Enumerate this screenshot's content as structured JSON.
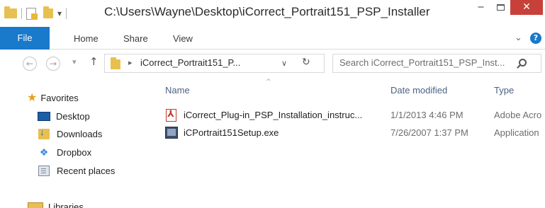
{
  "window": {
    "title": "C:\\Users\\Wayne\\Desktop\\iCorrect_Portrait151_PSP_Installer",
    "minimize_glyph": "‒",
    "close_glyph": "✕"
  },
  "ribbon": {
    "tabs": [
      "File",
      "Home",
      "Share",
      "View"
    ],
    "expand_glyph": "⌄",
    "help_glyph": "?"
  },
  "navigation": {
    "back_glyph": "←",
    "forward_glyph": "→",
    "recent_glyph": "▾",
    "up_glyph": "↑",
    "address_separator": "▸",
    "address_crumb": "iCorrect_Portrait151_P...",
    "address_dropdown_glyph": "∨",
    "refresh_glyph": "↻",
    "search_placeholder": "Search iCorrect_Portrait151_PSP_Inst..."
  },
  "sidebar": {
    "favorites_label": "Favorites",
    "items": [
      {
        "label": "Desktop",
        "icon": "desktop-icon"
      },
      {
        "label": "Downloads",
        "icon": "downloads-folder-icon"
      },
      {
        "label": "Dropbox",
        "icon": "dropbox-icon"
      },
      {
        "label": "Recent places",
        "icon": "recent-places-icon"
      }
    ],
    "libraries_label": "Libraries"
  },
  "file_list": {
    "columns": {
      "name": "Name",
      "date": "Date modified",
      "type": "Type"
    },
    "sort_glyph": "^",
    "rows": [
      {
        "name": "iCorrect_Plug-in_PSP_Installation_instruc...",
        "date": "1/1/2013 4:46 PM",
        "type": "Adobe Acro",
        "icon": "pdf-file-icon"
      },
      {
        "name": "iCPortrait151Setup.exe",
        "date": "7/26/2007 1:37 PM",
        "type": "Application",
        "icon": "exe-file-icon"
      }
    ]
  }
}
